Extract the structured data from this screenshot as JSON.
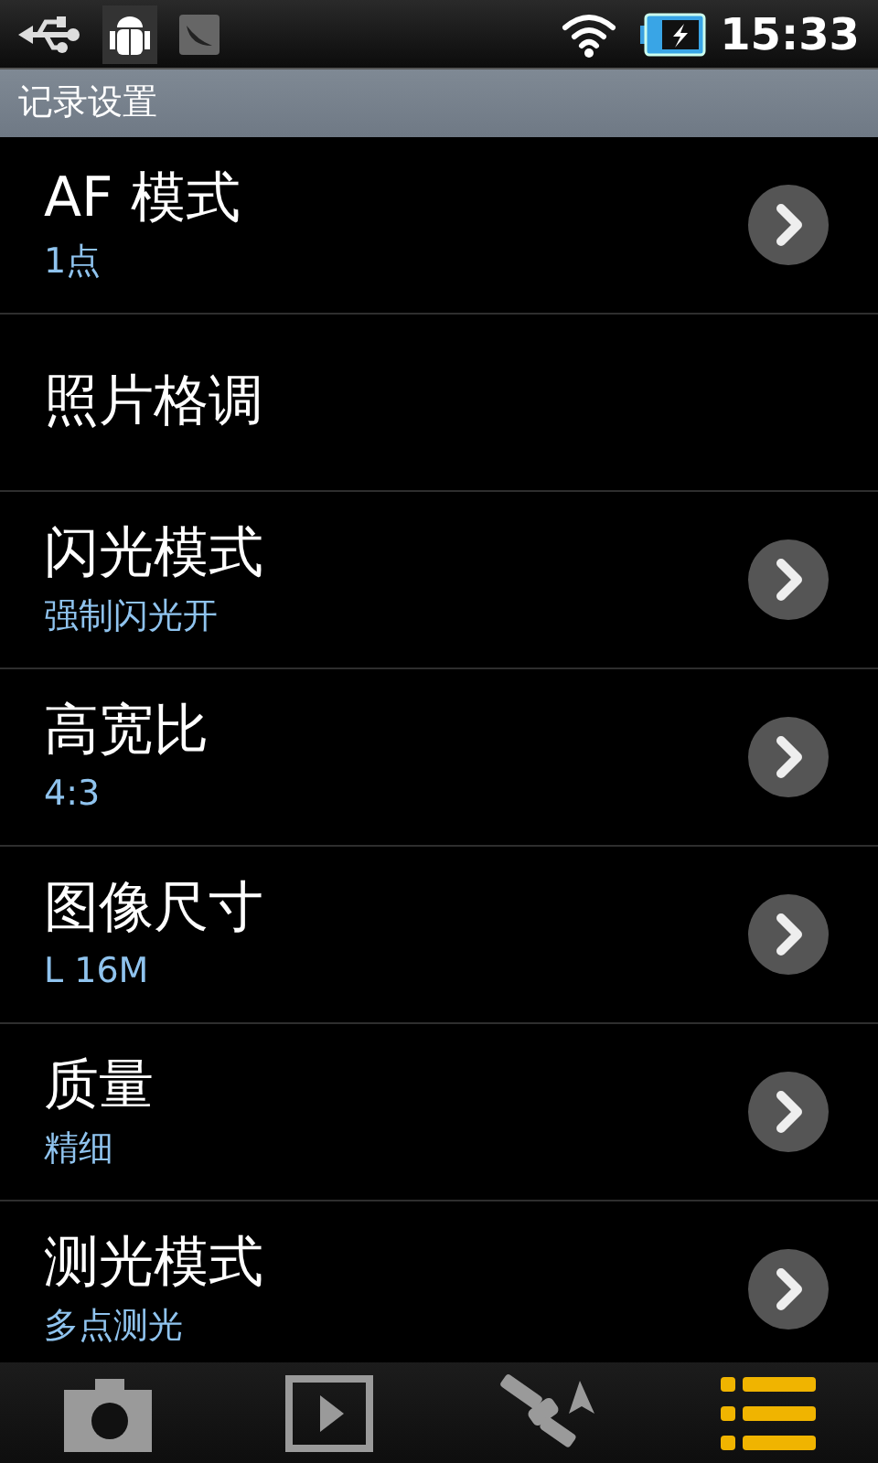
{
  "status_bar": {
    "time": "15:33"
  },
  "header": {
    "title": "记录设置"
  },
  "settings": [
    {
      "title": "AF 模式",
      "value": "1点",
      "has_arrow": true
    },
    {
      "title": "照片格调",
      "has_arrow": false
    },
    {
      "title": "闪光模式",
      "value": "强制闪光开",
      "has_arrow": true
    },
    {
      "title": "高宽比",
      "value": "4:3",
      "has_arrow": true
    },
    {
      "title": "图像尺寸",
      "value": "L 16M",
      "has_arrow": true
    },
    {
      "title": "质量",
      "value": "精细",
      "has_arrow": true
    },
    {
      "title": "测光模式",
      "value": "多点测光",
      "has_arrow": true
    }
  ],
  "bottom_tabs": [
    {
      "kind": "camera",
      "selected": false
    },
    {
      "kind": "playback",
      "selected": false
    },
    {
      "kind": "satellite",
      "selected": false
    },
    {
      "kind": "list",
      "selected": true
    }
  ]
}
